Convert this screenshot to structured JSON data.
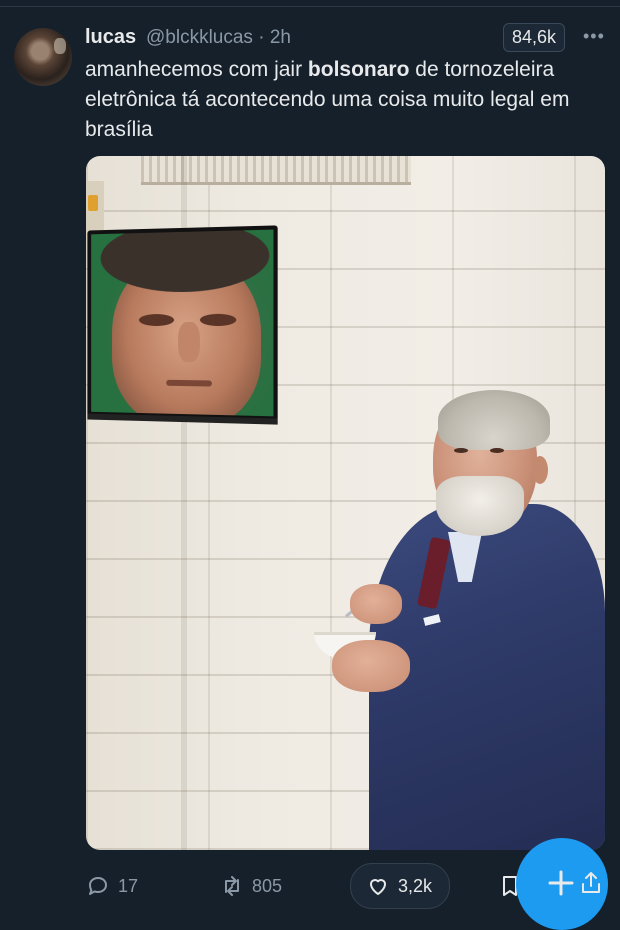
{
  "tweet": {
    "display_name": "lucas",
    "handle_time": "@blckklucas · 2h",
    "views": "84,6k",
    "text_before": "amanhecemos com jair ",
    "text_bold": "bolsonaro",
    "text_after": " de tornozeleira eletrônica tá acontecendo uma coisa muito legal em brasília"
  },
  "actions": {
    "replies": "17",
    "retweets": "805",
    "likes": "3,2k"
  },
  "colors": {
    "background": "#15202b",
    "accent": "#1d9bf0",
    "muted": "#8b98a5"
  }
}
